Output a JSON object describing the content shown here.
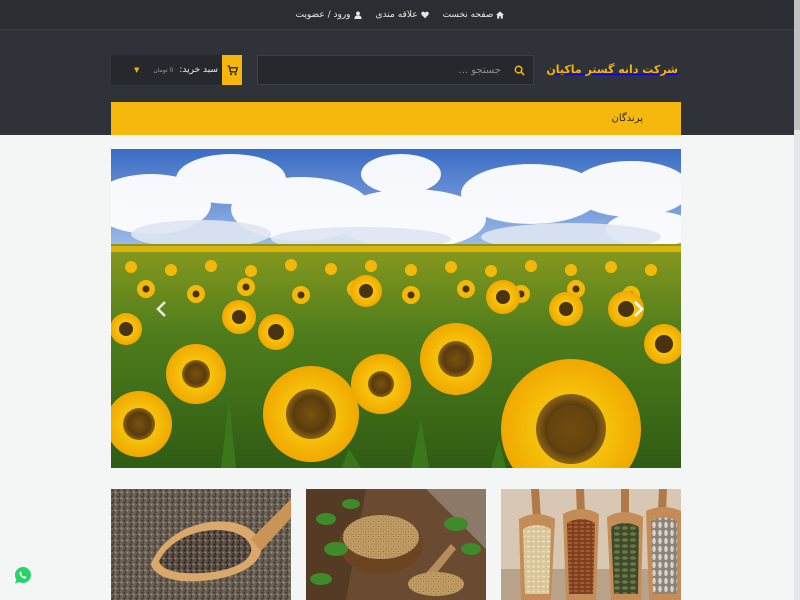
{
  "topnav": {
    "home_label": "صفحه نخست",
    "favorites_label": "علاقه مندی",
    "login_label": "ورود / عضویت"
  },
  "brand": {
    "name": "شرکت دانه گستر ماکیان",
    "accent_color": "#f5b50a"
  },
  "search": {
    "placeholder": "جستجو ...",
    "value": ""
  },
  "cart": {
    "label": "سبد خرید:",
    "amount": "0 تومان"
  },
  "menu": {
    "items": [
      {
        "label": "پرندگان"
      }
    ]
  },
  "slider": {
    "image": "sunflower-field",
    "prev_icon": "chevron-left-icon",
    "next_icon": "chevron-right-icon"
  },
  "products": [
    {
      "image": "chia-seeds-spoon"
    },
    {
      "image": "seed-bowl-with-herbs"
    },
    {
      "image": "seed-scoops-assortment"
    }
  ]
}
